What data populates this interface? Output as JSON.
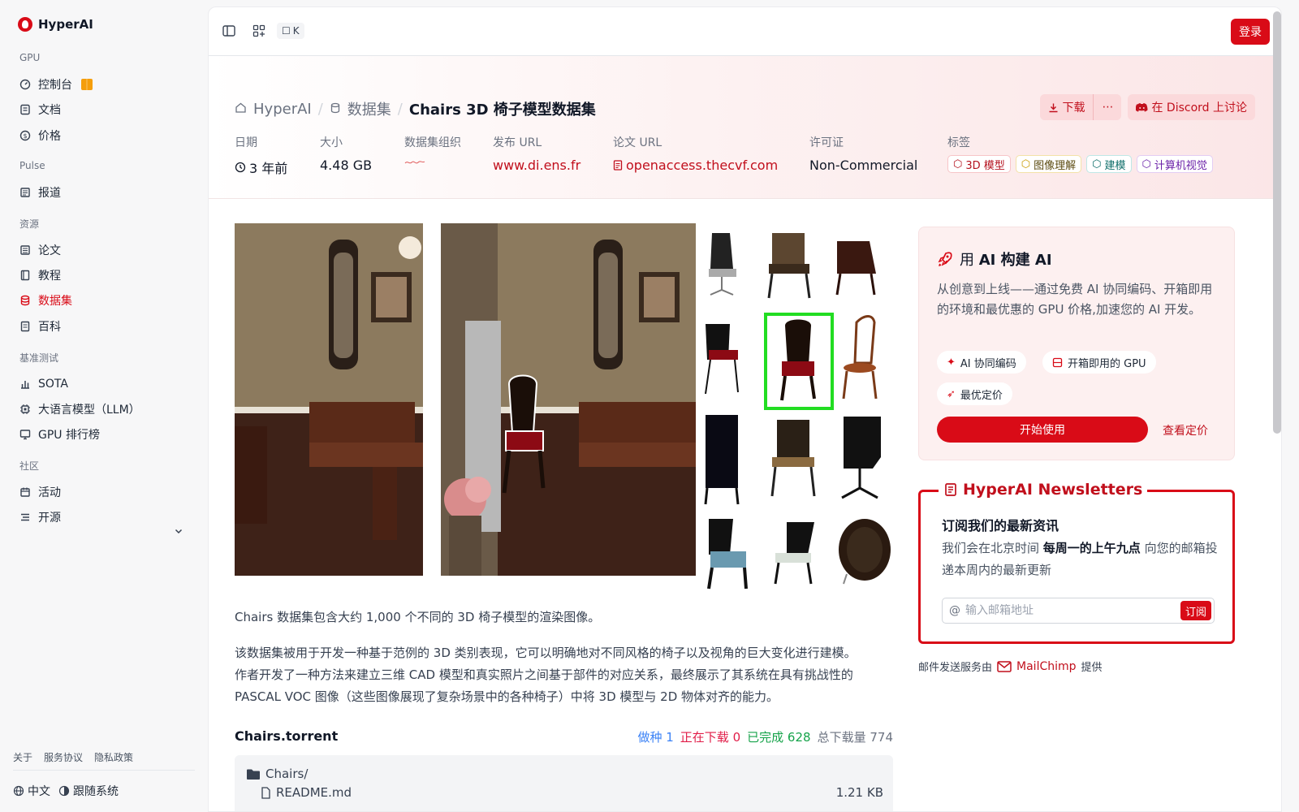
{
  "brand": {
    "name": "HyperAI"
  },
  "sidebar": {
    "sections": [
      {
        "label": "GPU",
        "items": [
          {
            "label": "控制台"
          },
          {
            "label": "文档"
          },
          {
            "label": "价格"
          }
        ]
      },
      {
        "label": "Pulse",
        "items": [
          {
            "label": "报道"
          }
        ]
      },
      {
        "label": "资源",
        "items": [
          {
            "label": "论文"
          },
          {
            "label": "教程"
          },
          {
            "label": "数据集",
            "active": true
          },
          {
            "label": "百科"
          }
        ]
      },
      {
        "label": "基准测试",
        "items": [
          {
            "label": "SOTA"
          },
          {
            "label": "大语言模型（LLM）"
          },
          {
            "label": "GPU 排行榜"
          }
        ]
      },
      {
        "label": "社区",
        "items": [
          {
            "label": "活动"
          },
          {
            "label": "开源"
          }
        ]
      }
    ],
    "footer_links": [
      "关于",
      "服务协议",
      "隐私政策"
    ],
    "language": "中文",
    "theme": "跟随系统"
  },
  "topbar": {
    "shortcut": "K",
    "login": "登录"
  },
  "breadcrumb": {
    "home": "HyperAI",
    "section": "数据集",
    "current": "Chairs 3D 椅子模型数据集"
  },
  "actions": {
    "download": "下载",
    "discord": "在 Discord 上讨论"
  },
  "meta": {
    "date_label": "日期",
    "date_value": "3 年前",
    "size_label": "大小",
    "size_value": "4.48 GB",
    "org_label": "数据集组织",
    "publish_label": "发布 URL",
    "publish_value": "www.di.ens.fr",
    "paper_label": "论文 URL",
    "paper_value": "openaccess.thecvf.com",
    "license_label": "许可证",
    "license_value": "Non-Commercial",
    "tags_label": "标签",
    "tags": [
      "3D 模型",
      "图像理解",
      "建模",
      "计算机视觉"
    ]
  },
  "content": {
    "intro": "Chairs 数据集包含大约 1,000 个不同的 3D 椅子模型的渲染图像。",
    "body_lines": [
      "该数据集被用于开发一种基于范例的 3D 类别表现，它可以明确地对不同风格的椅子以及视角的巨大变化进行建模。",
      "作者开发了一种方法来建立三维 CAD 模型和真实照片之间基于部件的对应关系，最终展示了其系统在具有挑战性的",
      "PASCAL VOC 图像（这些图像展现了复杂场景中的各种椅子）中将 3D 模型与 2D 物体对齐的能力。"
    ],
    "torrent_title": "Chairs.torrent",
    "stats": {
      "seed_label": "做种",
      "seed": "1",
      "downloading_label": "正在下载",
      "downloading": "0",
      "done_label": "已完成",
      "done": "628",
      "total_label": "总下载量",
      "total": "774"
    },
    "files": {
      "folder": "Chairs/",
      "file": "README.md",
      "file_size": "1.21 KB"
    }
  },
  "promo": {
    "title_prefix": "用 ",
    "title_bold": "AI 构建 AI",
    "text": "从创意到上线——通过免费 AI 协同编码、开箱即用的环境和最优惠的 GPU 价格,加速您的 AI 开发。",
    "chips": [
      "AI 协同编码",
      "开箱即用的 GPU",
      "最优定价"
    ],
    "start": "开始使用",
    "pricing": "查看定价"
  },
  "newsletter": {
    "title": "HyperAI Newsletters",
    "heading": "订阅我们的最新资讯",
    "text_a": "我们会在北京时间 ",
    "text_bold": "每周一的上午九点",
    "text_b": " 向您的邮箱投递本周内的最新更新",
    "placeholder": "输入邮箱地址",
    "subscribe": "订阅",
    "provider_prefix": "邮件发送服务由",
    "provider": "MailChimp",
    "provider_suffix": "提供"
  },
  "colors": {
    "accent": "#d90b17",
    "seed": "#3b82f6",
    "downloading": "#e11d48",
    "done": "#16a34a"
  }
}
